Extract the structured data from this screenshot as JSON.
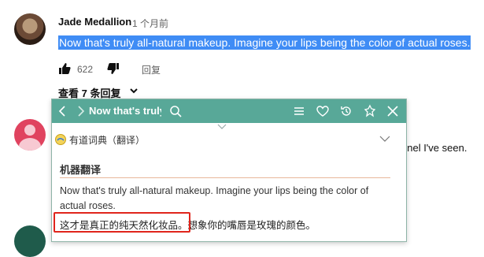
{
  "comment": {
    "author": "Jade Medallion",
    "time": "1 个月前",
    "text": "Now that's truly all-natural makeup. Imagine your lips being the color of actual roses.",
    "like_count": "622",
    "reply_label": "回复",
    "view_replies_label": "查看 7 条回复"
  },
  "behind_text": "nnel I've seen.",
  "popup": {
    "query": "Now that's truly",
    "dictionary_label": "有道词典（翻译）",
    "section_heading": "机器翻译",
    "source_text": "Now that's truly all-natural makeup. Imagine your lips being the color of actual roses.",
    "translation": "这才是真正的纯天然化妆品。想象你的嘴唇是玫瑰的颜色。",
    "colors": {
      "toolbar": "#58a898",
      "highlight_box": "#e0251c",
      "selection": "#3f8cf5"
    }
  }
}
